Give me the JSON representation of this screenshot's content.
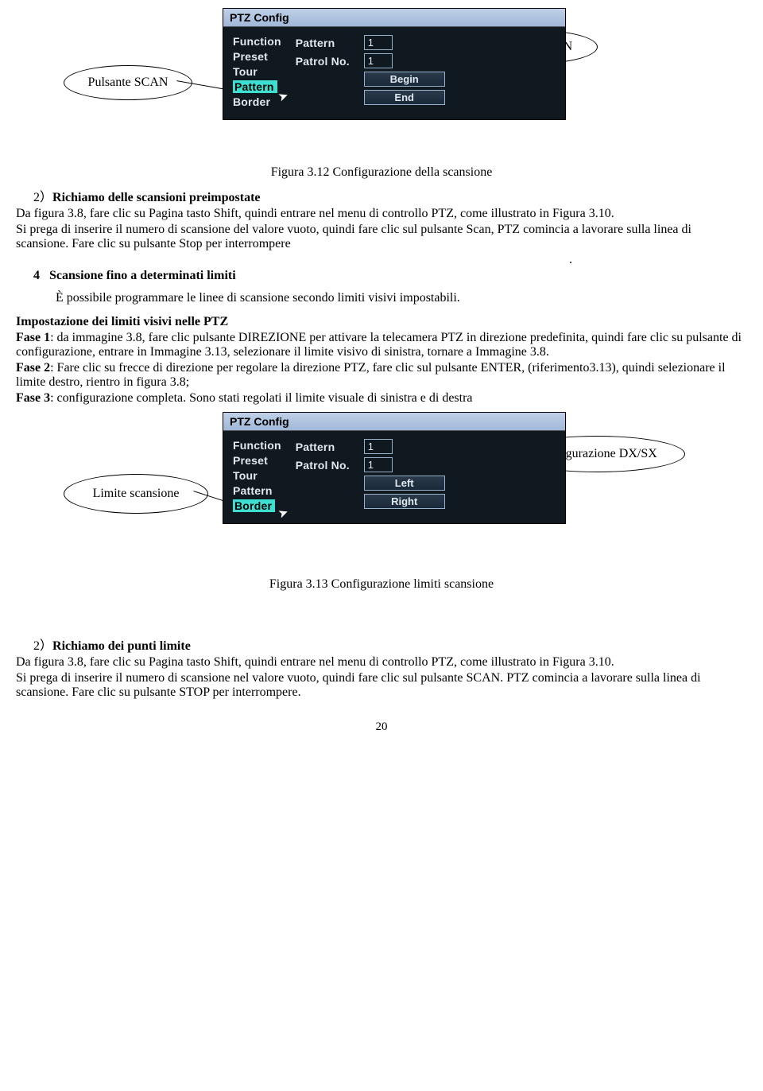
{
  "screenshot1": {
    "title": "PTZ Config",
    "col_left": [
      "Function",
      "Preset",
      "Tour",
      "Pattern",
      "Border"
    ],
    "highlight_index": 3,
    "right_row1_label": "Pattern",
    "right_row1_value": "1",
    "right_row2_label": "Patrol No.",
    "right_row2_value": "1",
    "btn1": "Begin",
    "btn2": "End",
    "callout_scan_value": "Valore SCAN",
    "callout_scan_button": "Pulsante SCAN"
  },
  "caption1": "Figura 3.12 Configurazione della scansione",
  "sec2_num": "2）",
  "sec2_title": "Richiamo delle scansioni preimpostate",
  "para2a": "Da figura 3.8, fare clic su Pagina tasto Shift, quindi entrare nel menu di controllo PTZ, come illustrato in Figura 3.10.",
  "para2b": "Si prega di inserire il numero di scansione del valore vuoto, quindi fare clic sul pulsante Scan, PTZ comincia a lavorare sulla linea di scansione. Fare clic su pulsante Stop per interrompere",
  "para2c": ".",
  "sec4_num": "4",
  "sec4_title": "Scansione fino a determinati limiti",
  "para4a": "È possibile programmare le linee di scansione secondo limiti visivi impostabili.",
  "heading_limits": "Impostazione dei limiti visivi nelle PTZ",
  "phase1_label": "Fase 1",
  "phase1_text": ": da immagine 3.8, fare clic pulsante DIREZIONE per attivare la telecamera PTZ in direzione predefinita, quindi fare clic su pulsante di configurazione, entrare in Immagine 3.13, selezionare il limite visivo di sinistra, tornare a Immagine 3.8.",
  "phase2_label": "Fase 2",
  "phase2_text": ": Fare clic su frecce di direzione per regolare la direzione PTZ, fare clic sul pulsante ENTER, (riferimento3.13), quindi selezionare il limite destro, rientro in figura 3.8;",
  "phase3_label": "Fase 3",
  "phase3_text": ": configurazione completa. Sono stati regolati il limite visuale di sinistra e di destra",
  "screenshot2": {
    "title": "PTZ Config",
    "col_left": [
      "Function",
      "Preset",
      "Tour",
      "Pattern",
      "Border"
    ],
    "highlight_index": 4,
    "right_row1_label": "Pattern",
    "right_row1_value": "1",
    "right_row2_label": "Patrol No.",
    "right_row2_value": "1",
    "btn1": "Left",
    "btn2": "Right",
    "callout_dxsx": "Configurazione DX/SX",
    "callout_limit": "Limite scansione"
  },
  "caption2": "Figura 3.13 Configurazione limiti scansione",
  "sec2b_num": "2）",
  "sec2b_title": "Richiamo dei punti limite",
  "para_bot1": "Da figura 3.8, fare clic su Pagina tasto Shift, quindi entrare nel menu di controllo PTZ, come illustrato in Figura 3.10.",
  "para_bot2": "Si prega di inserire il numero di scansione nel valore vuoto, quindi fare clic sul pulsante SCAN. PTZ comincia a lavorare sulla linea di scansione. Fare clic su pulsante STOP per interrompere.",
  "page": "20"
}
